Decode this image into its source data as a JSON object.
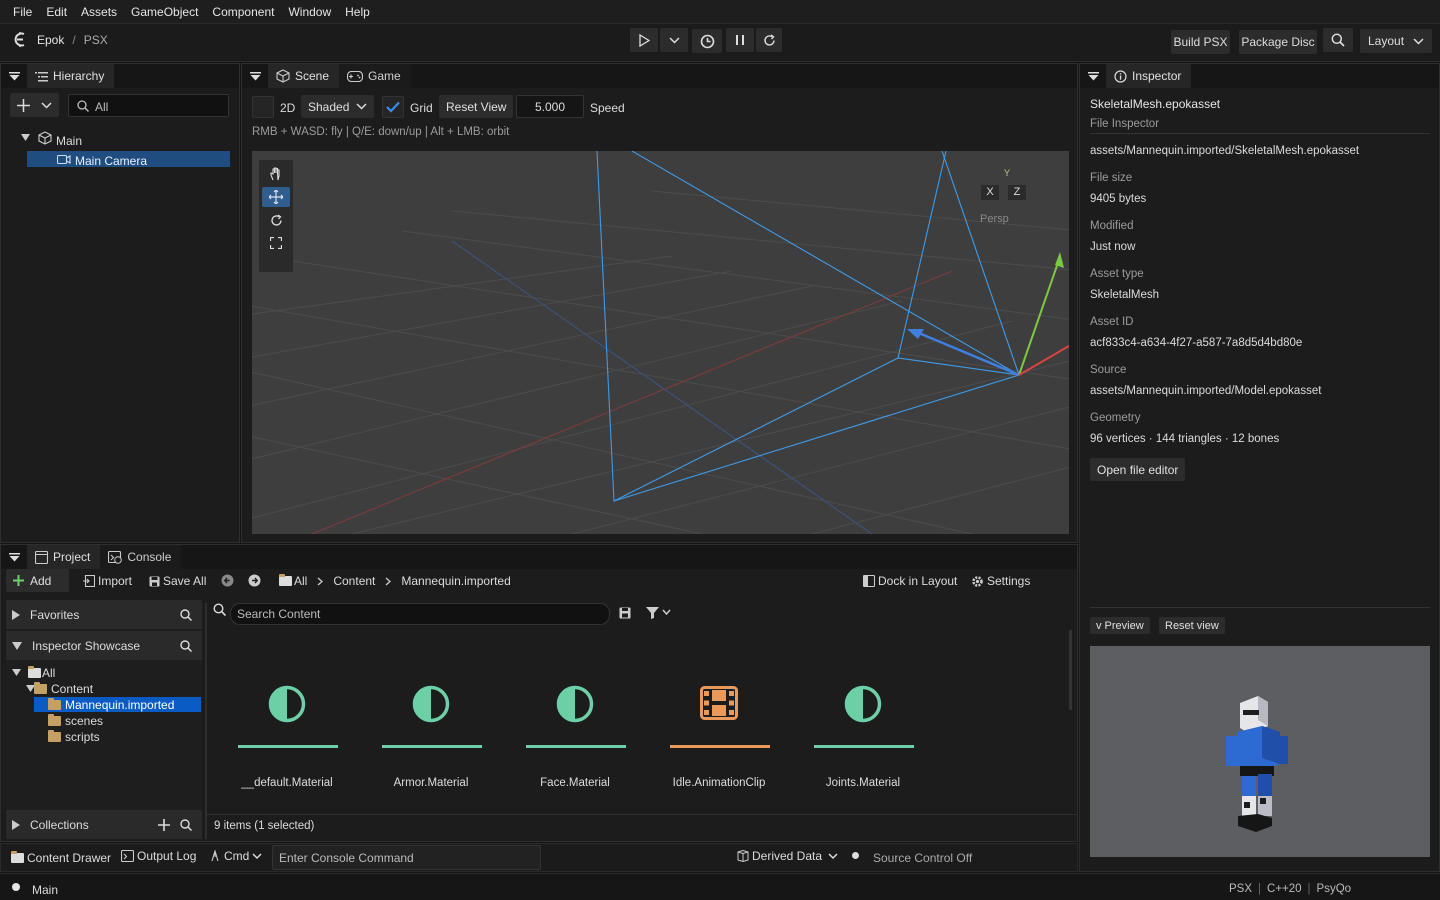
{
  "menu": [
    "File",
    "Edit",
    "Assets",
    "GameObject",
    "Component",
    "Window",
    "Help"
  ],
  "toolbar": {
    "app": "Epok",
    "sep": "/",
    "project": "PSX",
    "build_label": "Build PSX",
    "package_label": "Package Disc",
    "layout_label": "Layout"
  },
  "hierarchy": {
    "tab": "Hierarchy",
    "search_placeholder": "All",
    "items": [
      {
        "label": "Main"
      },
      {
        "label": "Main Camera"
      }
    ]
  },
  "scene": {
    "tabs": [
      "Scene",
      "Game"
    ],
    "mode_2d": "2D",
    "shading": "Shaded",
    "grid_label": "Grid",
    "reset_view": "Reset View",
    "speed_value": "5.000",
    "speed_label": "Speed",
    "hint": "RMB + WASD: fly | Q/E: down/up | Alt + LMB: orbit",
    "gizmo_axes": [
      "X",
      "Y",
      "Z"
    ],
    "projection": "Persp"
  },
  "inspector": {
    "tab": "Inspector",
    "title": "SkeletalMesh.epokasset",
    "subtitle": "File Inspector",
    "path": "assets/Mannequin.imported/SkeletalMesh.epokasset",
    "fields": [
      {
        "label": "File size",
        "value": "9405 bytes"
      },
      {
        "label": "Modified",
        "value": "Just now"
      },
      {
        "label": "Asset type",
        "value": "SkeletalMesh"
      },
      {
        "label": "Asset ID",
        "value": "acf833c4-a634-4f27-a587-7a8d5d4bd80e"
      },
      {
        "label": "Source",
        "value": "assets/Mannequin.imported/Model.epokasset"
      },
      {
        "label": "Geometry",
        "value": "96 vertices · 144 triangles · 12 bones"
      }
    ],
    "open_editor": "Open file editor",
    "preview_toggle": "v Preview",
    "reset_view": "Reset view"
  },
  "project": {
    "tabs": [
      "Project",
      "Console"
    ],
    "add": "Add",
    "import": "Import",
    "save_all": "Save All",
    "breadcrumb": [
      "All",
      "Content",
      "Mannequin.imported"
    ],
    "dock": "Dock in Layout",
    "settings": "Settings",
    "favorites": "Favorites",
    "showcase": "Inspector Showcase",
    "tree": [
      "All",
      "Content",
      "Mannequin.imported",
      "scenes",
      "scripts"
    ],
    "collections": "Collections",
    "search_placeholder": "Search Content",
    "assets": [
      {
        "name": "__default.Material",
        "icon": "material-icon",
        "color": "#6ccfa5"
      },
      {
        "name": "Armor.Material",
        "icon": "material-icon",
        "color": "#6ccfa5"
      },
      {
        "name": "Face.Material",
        "icon": "material-icon",
        "color": "#6ccfa5"
      },
      {
        "name": "Idle.AnimationClip",
        "icon": "film-icon",
        "color": "#e99a5a"
      },
      {
        "name": "Joints.Material",
        "icon": "material-icon",
        "color": "#6ccfa5"
      }
    ],
    "status": "9 items (1 selected)"
  },
  "drawer": {
    "content_drawer": "Content Drawer",
    "output_log": "Output Log",
    "cmd": "Cmd",
    "console_placeholder": "Enter Console Command",
    "derived_data": "Derived Data",
    "source_control": "Source Control Off"
  },
  "statusbar": {
    "scene": "Main",
    "right": [
      "PSX",
      "C++20",
      "PsyQo"
    ]
  },
  "colors": {
    "accent": "#2d6bb7",
    "selection": "#0a5bc4",
    "material": "#6ccfa5",
    "animation": "#e99a5a"
  }
}
